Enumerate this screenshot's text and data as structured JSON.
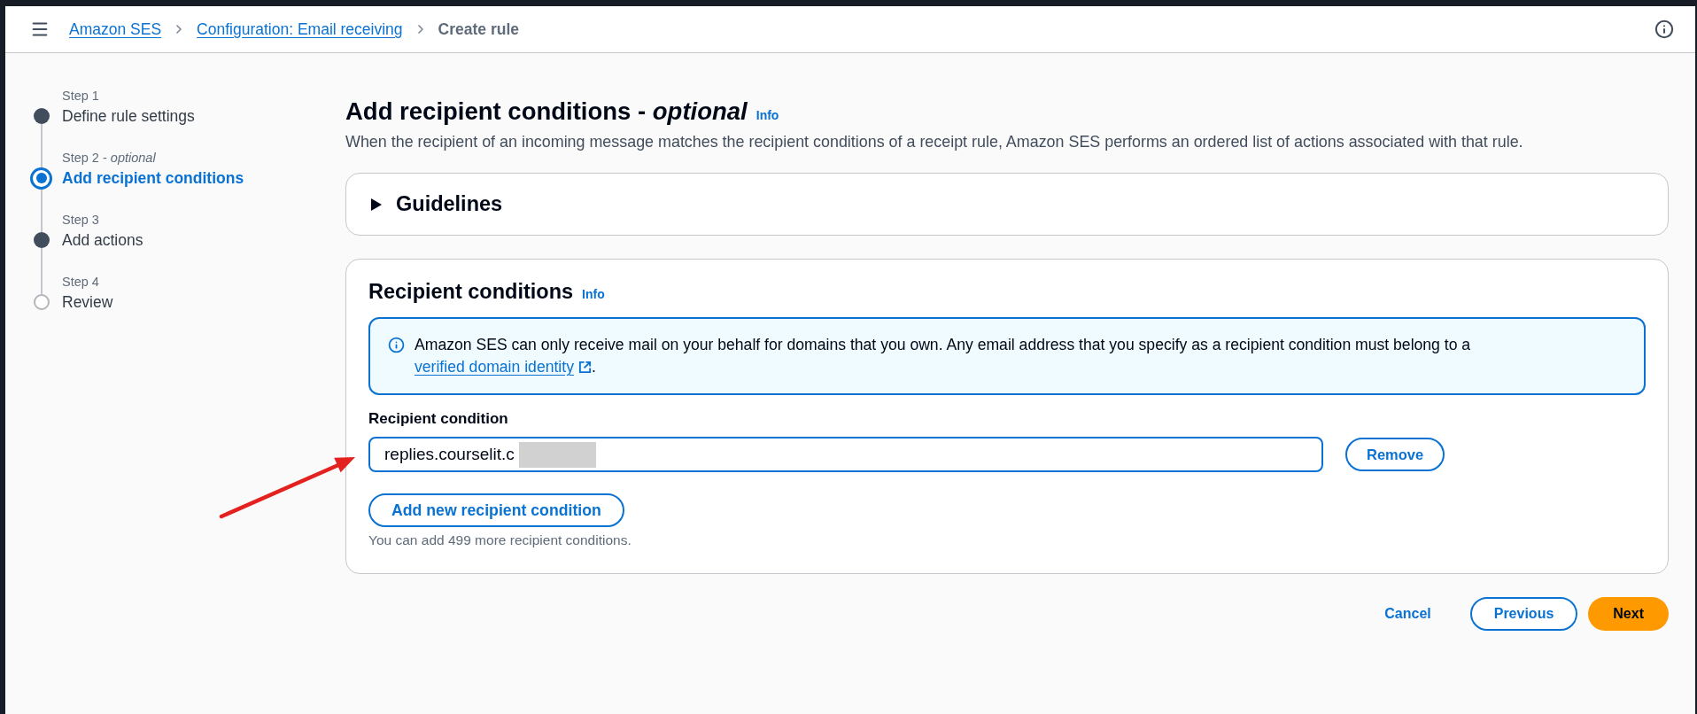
{
  "top_bar": {
    "breadcrumbs": [
      {
        "label": "Amazon SES",
        "kind": "link"
      },
      {
        "label": "Configuration: Email receiving",
        "kind": "link"
      },
      {
        "label": "Create rule",
        "kind": "current"
      }
    ]
  },
  "steps": [
    {
      "label": "Step 1",
      "title": "Define rule settings",
      "kind": "filled",
      "selected": false
    },
    {
      "label": "Step 2 - *optional*",
      "title": "Add recipient conditions",
      "kind": "current",
      "selected": true
    },
    {
      "label": "Step 3",
      "title": "Add actions",
      "kind": "filled",
      "selected": false
    },
    {
      "label": "Step 4",
      "title": "Review",
      "kind": "hollow",
      "selected": false
    }
  ],
  "page_header": {
    "title": "Add recipient conditions - *optional*",
    "info": "Info",
    "description": "When the recipient of an incoming message matches the recipient conditions of a receipt rule, Amazon SES performs an ordered list of actions associated with that rule."
  },
  "guidelines": {
    "title": "Guidelines",
    "expanded": false
  },
  "recipient_conditions": {
    "title": "Recipient conditions",
    "info": "Info",
    "alert": {
      "text": "Amazon SES can only receive mail on your behalf for domains that you own. Any email address that you specify as a recipient condition must belong to a",
      "link": "verified domain identity",
      "after": "."
    },
    "field_label": "Recipient condition",
    "conditions": [
      {
        "value": "replies.courselit.c",
        "redacted": true,
        "focused": true,
        "remove": "Remove"
      }
    ],
    "add_button": "Add new recipient condition",
    "hint": "You can add 499 more recipient conditions."
  },
  "footer": {
    "buttons": [
      {
        "label": "Cancel",
        "kind": "link"
      },
      {
        "label": "Previous",
        "kind": "normal"
      },
      {
        "label": "Next",
        "kind": "primary"
      }
    ]
  }
}
